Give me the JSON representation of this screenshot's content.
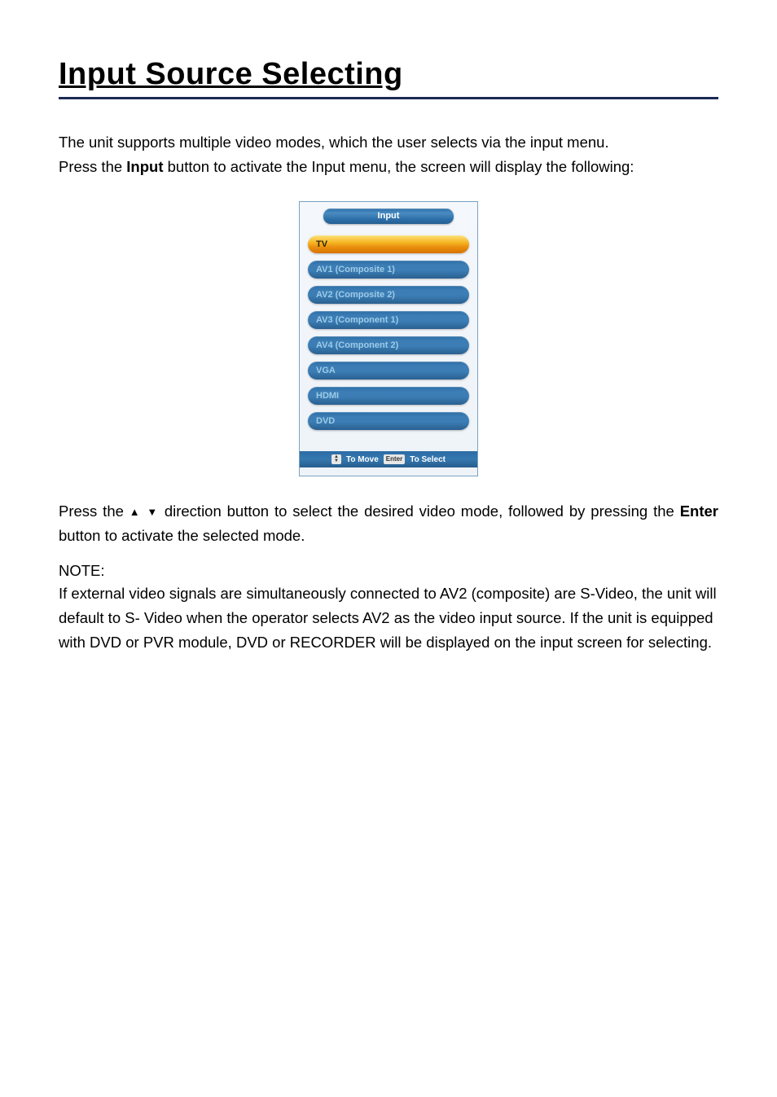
{
  "page": {
    "title": "Input Source Selecting"
  },
  "paragraphs": {
    "p1": "The unit supports multiple video modes, which the user selects via the input menu.",
    "p2_pre": "Press the ",
    "p2_bold": "Input",
    "p2_post": " button to activate the Input menu, the screen will display the following:",
    "p3_pre": "Press the ",
    "p3_mid": " direction button to select the desired video mode, followed by pressing the ",
    "p3_bold": "Enter",
    "p3_post": " button to activate the selected mode.",
    "note_heading": "NOTE:",
    "note_body": "If external video signals are simultaneously connected to AV2 (composite) are S-Video, the unit will default to S- Video when the operator selects AV2 as the video input source. If the unit is equipped with DVD or PVR module, DVD or RECORDER will be displayed on the input screen for selecting."
  },
  "osd": {
    "title": "Input",
    "items": [
      {
        "label": "TV",
        "selected": true
      },
      {
        "label": "AV1 (Composite 1)",
        "selected": false
      },
      {
        "label": "AV2 (Composite 2)",
        "selected": false
      },
      {
        "label": "AV3 (Component 1)",
        "selected": false
      },
      {
        "label": "AV4 (Component 2)",
        "selected": false
      },
      {
        "label": "VGA",
        "selected": false
      },
      {
        "label": "HDMI",
        "selected": false
      },
      {
        "label": "DVD",
        "selected": false
      }
    ],
    "footer": {
      "move_label": "To Move",
      "enter_key": "Enter",
      "select_label": "To Select"
    }
  },
  "arrows": {
    "up": "▲",
    "down": "▼"
  }
}
